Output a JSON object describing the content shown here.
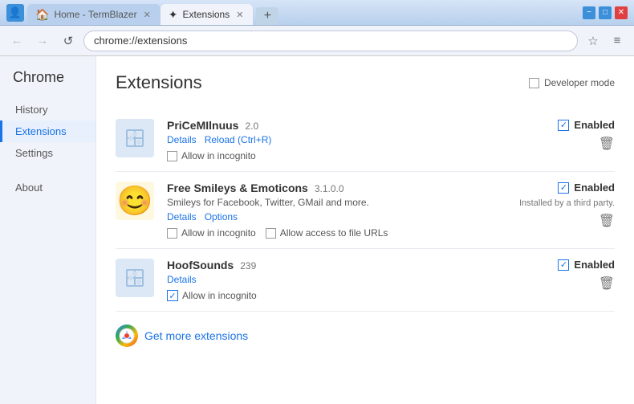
{
  "window": {
    "title_bar": {
      "tabs": [
        {
          "label": "Home - TermBlazer",
          "active": false,
          "icon": "🏠"
        },
        {
          "label": "Extensions",
          "active": true,
          "icon": "✦"
        }
      ],
      "new_tab_label": "+",
      "user_icon": "👤",
      "min_label": "−",
      "max_label": "□",
      "close_label": "✕"
    },
    "nav_bar": {
      "back_label": "←",
      "forward_label": "→",
      "reload_label": "↺",
      "address": "chrome://extensions",
      "star_label": "☆",
      "menu_label": "≡"
    }
  },
  "sidebar": {
    "title": "Chrome",
    "items": [
      {
        "label": "History",
        "active": false,
        "id": "history"
      },
      {
        "label": "Extensions",
        "active": true,
        "id": "extensions"
      },
      {
        "label": "Settings",
        "active": false,
        "id": "settings"
      },
      {
        "label": "About",
        "active": false,
        "id": "about"
      }
    ]
  },
  "content": {
    "title": "Extensions",
    "developer_mode_label": "Developer mode",
    "extensions": [
      {
        "id": "pricemilnuus",
        "name": "PriCeMIlnuus",
        "version": "2.0",
        "description": "",
        "links": [
          {
            "label": "Details",
            "id": "details"
          },
          {
            "label": "Reload (Ctrl+R)",
            "id": "reload"
          }
        ],
        "incognito": {
          "show": true,
          "label": "Allow in incognito",
          "checked": false
        },
        "file_access": {
          "show": false
        },
        "enabled": true,
        "enabled_label": "Enabled",
        "third_party": false,
        "icon_type": "puzzle"
      },
      {
        "id": "free-smileys",
        "name": "Free Smileys & Emoticons",
        "version": "3.1.0.0",
        "description": "Smileys for Facebook, Twitter, GMail and more.",
        "links": [
          {
            "label": "Details",
            "id": "details"
          },
          {
            "label": "Options",
            "id": "options"
          }
        ],
        "incognito": {
          "show": true,
          "label": "Allow in incognito",
          "checked": false
        },
        "file_access": {
          "show": true,
          "label": "Allow access to file URLs",
          "checked": false
        },
        "enabled": true,
        "enabled_label": "Enabled",
        "third_party": true,
        "third_party_note": "Installed by a third party.",
        "icon_type": "emoji"
      },
      {
        "id": "hoofsounds",
        "name": "HoofSounds",
        "version": "239",
        "description": "",
        "links": [
          {
            "label": "Details",
            "id": "details"
          }
        ],
        "incognito": {
          "show": true,
          "label": "Allow in incognito",
          "checked": true
        },
        "file_access": {
          "show": false
        },
        "enabled": true,
        "enabled_label": "Enabled",
        "third_party": false,
        "icon_type": "puzzle"
      }
    ],
    "get_more": {
      "label": "Get more extensions",
      "icon": "chrome"
    }
  }
}
